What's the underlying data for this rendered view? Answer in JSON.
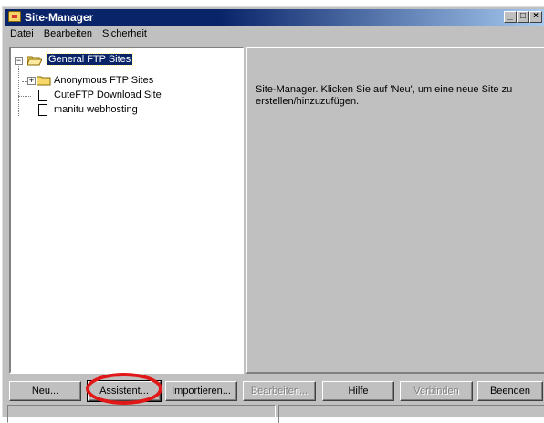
{
  "window": {
    "title": "Site-Manager",
    "buttons": [
      "minimize-icon",
      "maximize-icon",
      "close-icon"
    ]
  },
  "menu": [
    {
      "label": "Datei"
    },
    {
      "label": "Bearbeiten"
    },
    {
      "label": "Sicherheit"
    }
  ],
  "tree": {
    "root": {
      "label": "General FTP Sites",
      "expander": "−",
      "icon": "folder-open-icon"
    },
    "children": [
      {
        "label": "Anonymous FTP Sites",
        "expander": "+",
        "icon": "folder-icon"
      },
      {
        "label": "CuteFTP Download Site",
        "icon": "document-icon"
      },
      {
        "label": "manitu webhosting",
        "icon": "document-icon"
      }
    ]
  },
  "detail": {
    "text": "Site-Manager. Klicken Sie auf 'Neu', um eine neue Site zu erstellen/hinzuzufügen."
  },
  "buttons": {
    "neu": "Neu...",
    "assistent": "Assistent...",
    "importieren": "Importieren...",
    "bearbeiten": "Bearbeiten...",
    "hilfe": "Hilfe",
    "verbinden": "Verbinden",
    "beenden": "Beenden"
  },
  "colors": {
    "title_bar": "#0a246a",
    "selection": "#0a246a",
    "annotation": "#e01818",
    "face": "#c0c0c0"
  }
}
